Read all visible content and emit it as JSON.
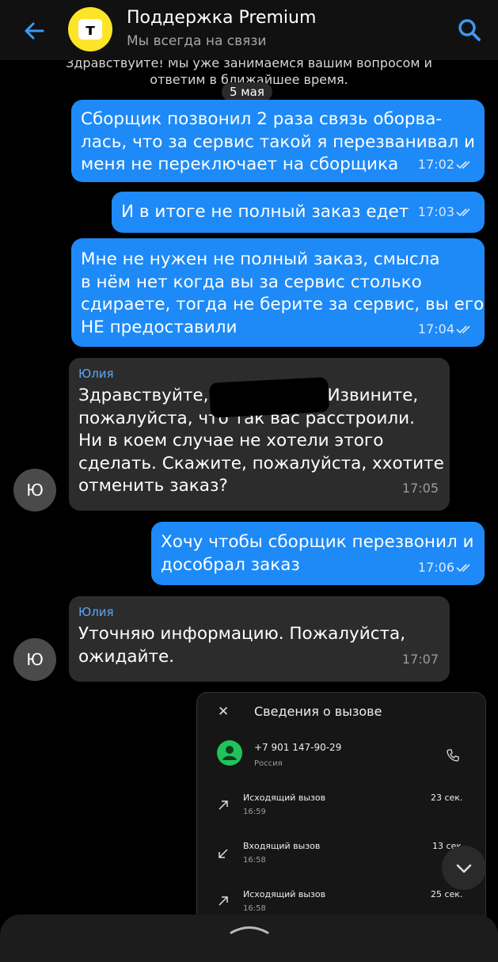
{
  "header": {
    "title": "Поддержка Premium",
    "subtitle": "Мы всегда на связи",
    "logo_letter": "т"
  },
  "clipped_message": {
    "line1": "Здравствуйте! Мы уже занимаемся вашим вопросом и",
    "line2": "ответим в ближайшее время."
  },
  "date_separator": "5 мая",
  "messages": [
    {
      "lines": [
        "Сборщик позвонил 2 раза связь оборва-",
        "лась, что за сервис такой я перезванивал и",
        "меня не переключает на сборщика"
      ],
      "time": "17:02"
    },
    {
      "lines": [
        "И в итоге не полный заказ едет"
      ],
      "time": "17:03"
    },
    {
      "lines": [
        "Мне не нужен не полный заказ, смысла",
        "в нём нет когда вы за сервис столько",
        "сдираете, тогда не берите за сервис, вы его",
        "НЕ предоставили"
      ],
      "time": "17:04"
    },
    {
      "sender": "Юлия",
      "avatar": "Ю",
      "lines": [
        "Здравствуйте,",
        "Извините,",
        "пожалуйста, что так вас расстроили.",
        "Ни в коем случае не хотели этого",
        "сделать. Скажите, пожалуйста, ххотите",
        "отменить заказ?"
      ],
      "time": "17:05"
    },
    {
      "lines": [
        "Хочу чтобы сборщик перезвонил и",
        "дособрал заказ"
      ],
      "time": "17:06"
    },
    {
      "sender": "Юлия",
      "avatar": "Ю",
      "lines": [
        "Уточняю информацию. Пожалуйста,",
        "ожидайте."
      ],
      "time": "17:07"
    }
  ],
  "call_details": {
    "title": "Сведения о вызове",
    "close": "✕",
    "number": "+7 901 147-90-29",
    "country": "Россия",
    "calls": [
      {
        "type": "Исходящий вызов",
        "time": "16:59",
        "duration": "23 сек."
      },
      {
        "type": "Входящий вызов",
        "time": "16:58",
        "duration": "13 сек."
      },
      {
        "type": "Исходящий вызов",
        "time": "16:58",
        "duration": "25 сек."
      }
    ]
  },
  "colors": {
    "accent": "#1d8af7",
    "incoming": "#2c2c2c",
    "logo": "#fde428"
  }
}
